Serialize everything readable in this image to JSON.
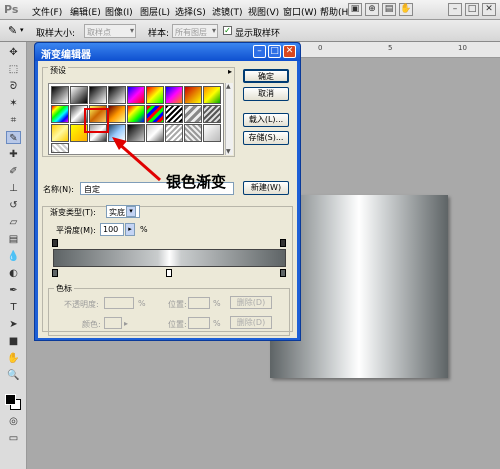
{
  "app": {
    "logo": "Ps"
  },
  "menu": [
    "文件(F)",
    "编辑(E)",
    "图像(I)",
    "图层(L)",
    "选择(S)",
    "滤镜(T)",
    "视图(V)",
    "窗口(W)",
    "帮助(H)"
  ],
  "options": {
    "sample_size_label": "取样大小:",
    "sample_size_value": "取样点",
    "sample_label": "样本:",
    "sample_value": "所有图层",
    "show_ring_label": "显示取样环"
  },
  "ruler": {
    "ticks": [
      "0",
      "5",
      "10"
    ]
  },
  "dialog": {
    "title": "渐变编辑器",
    "presets_label": "预设",
    "buttons": {
      "ok": "确定",
      "cancel": "取消",
      "load": "载入(L)...",
      "save": "存储(S)...",
      "new": "新建(W)"
    },
    "name_label": "名称(N):",
    "name_value": "自定",
    "gradient_type_label": "渐变类型(T):",
    "gradient_type_value": "实底",
    "smoothness_label": "平滑度(M):",
    "smoothness_value": "100",
    "smoothness_unit": "%",
    "stops_group_label": "色标",
    "opacity_label": "不透明度:",
    "opacity_unit": "%",
    "location_label": "位置:",
    "location_unit": "%",
    "delete_label": "删除(D)",
    "color_label": "颜色:",
    "location2_label": "位置:",
    "location2_unit": "%",
    "delete2_label": "删除(D)"
  },
  "annotation": {
    "text": "银色渐变"
  },
  "colors": {
    "accent": "#1d5fd6",
    "highlight": "#e00000",
    "silver_dark": "#5e6466",
    "silver_light": "#ffffff"
  }
}
